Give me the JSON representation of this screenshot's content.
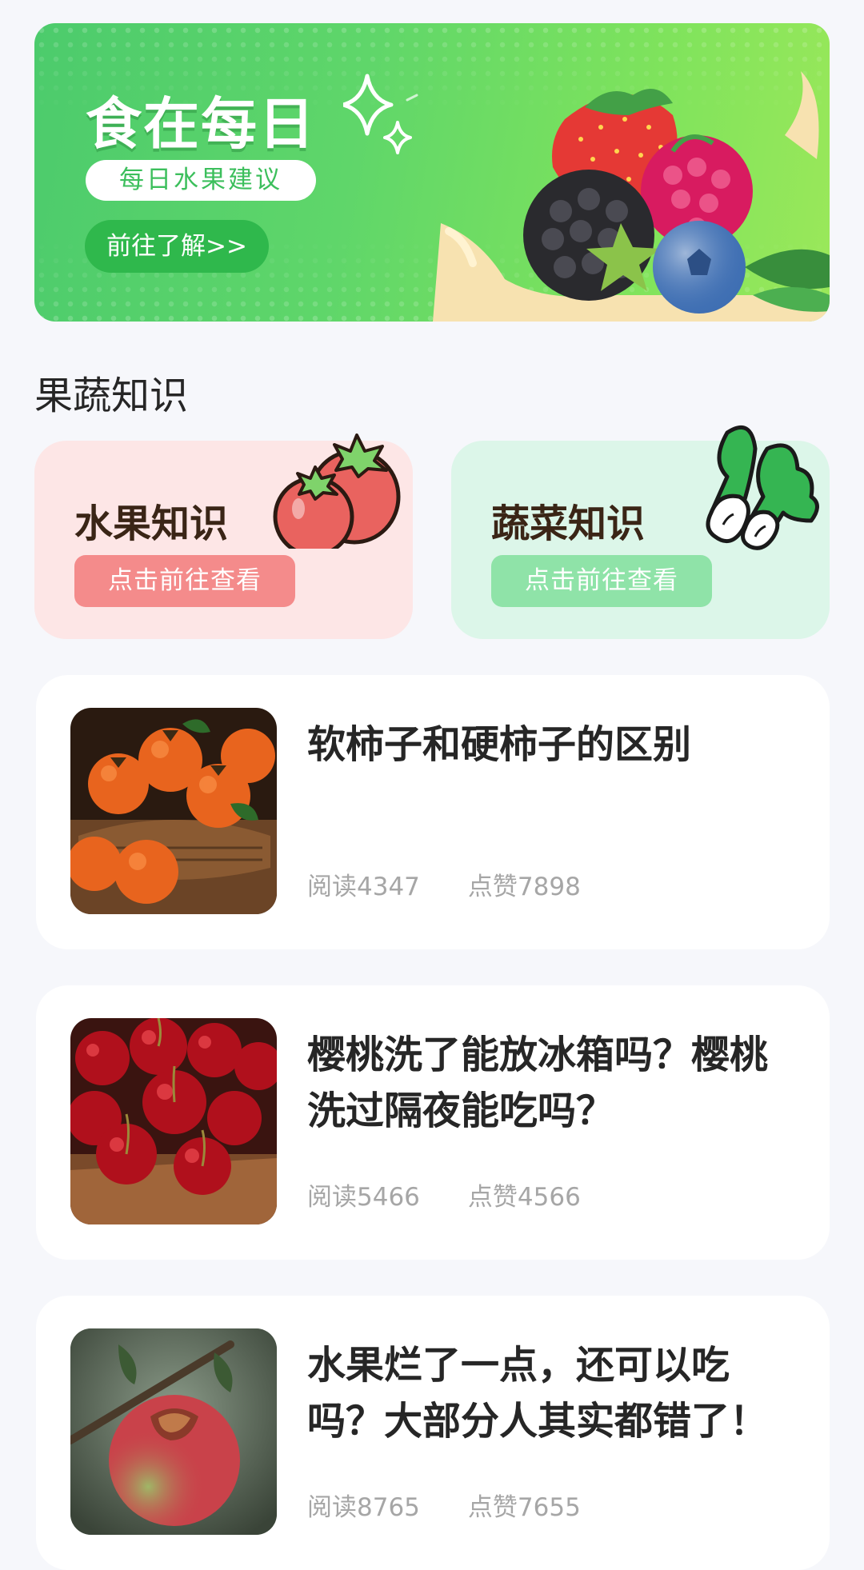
{
  "banner": {
    "title": "食在每日",
    "subtitle": "每日水果建议",
    "button_label": "前往了解>>"
  },
  "section": {
    "title": "果蔬知识"
  },
  "knowledge_cards": [
    {
      "label": "水果知识",
      "button_label": "点击前往查看",
      "color": "#fde6e6",
      "button_color": "#f48b8b"
    },
    {
      "label": "蔬菜知识",
      "button_label": "点击前往查看",
      "color": "#dcf6e9",
      "button_color": "#8fe3a8"
    }
  ],
  "articles": [
    {
      "title": "软柿子和硬柿子的区别",
      "reads": "阅读4347",
      "likes": "点赞7898"
    },
    {
      "title": "樱桃洗了能放冰箱吗？樱桃洗过隔夜能吃吗？",
      "reads": "阅读5466",
      "likes": "点赞4566"
    },
    {
      "title": "水果烂了一点，还可以吃吗？大部分人其实都错了！",
      "reads": "阅读8765",
      "likes": "点赞7655"
    }
  ],
  "colors": {
    "background": "#f6f7fb",
    "banner_green": "#4ccb6c",
    "accent_green": "#2fb84c",
    "meta_gray": "#a6a6a6"
  }
}
